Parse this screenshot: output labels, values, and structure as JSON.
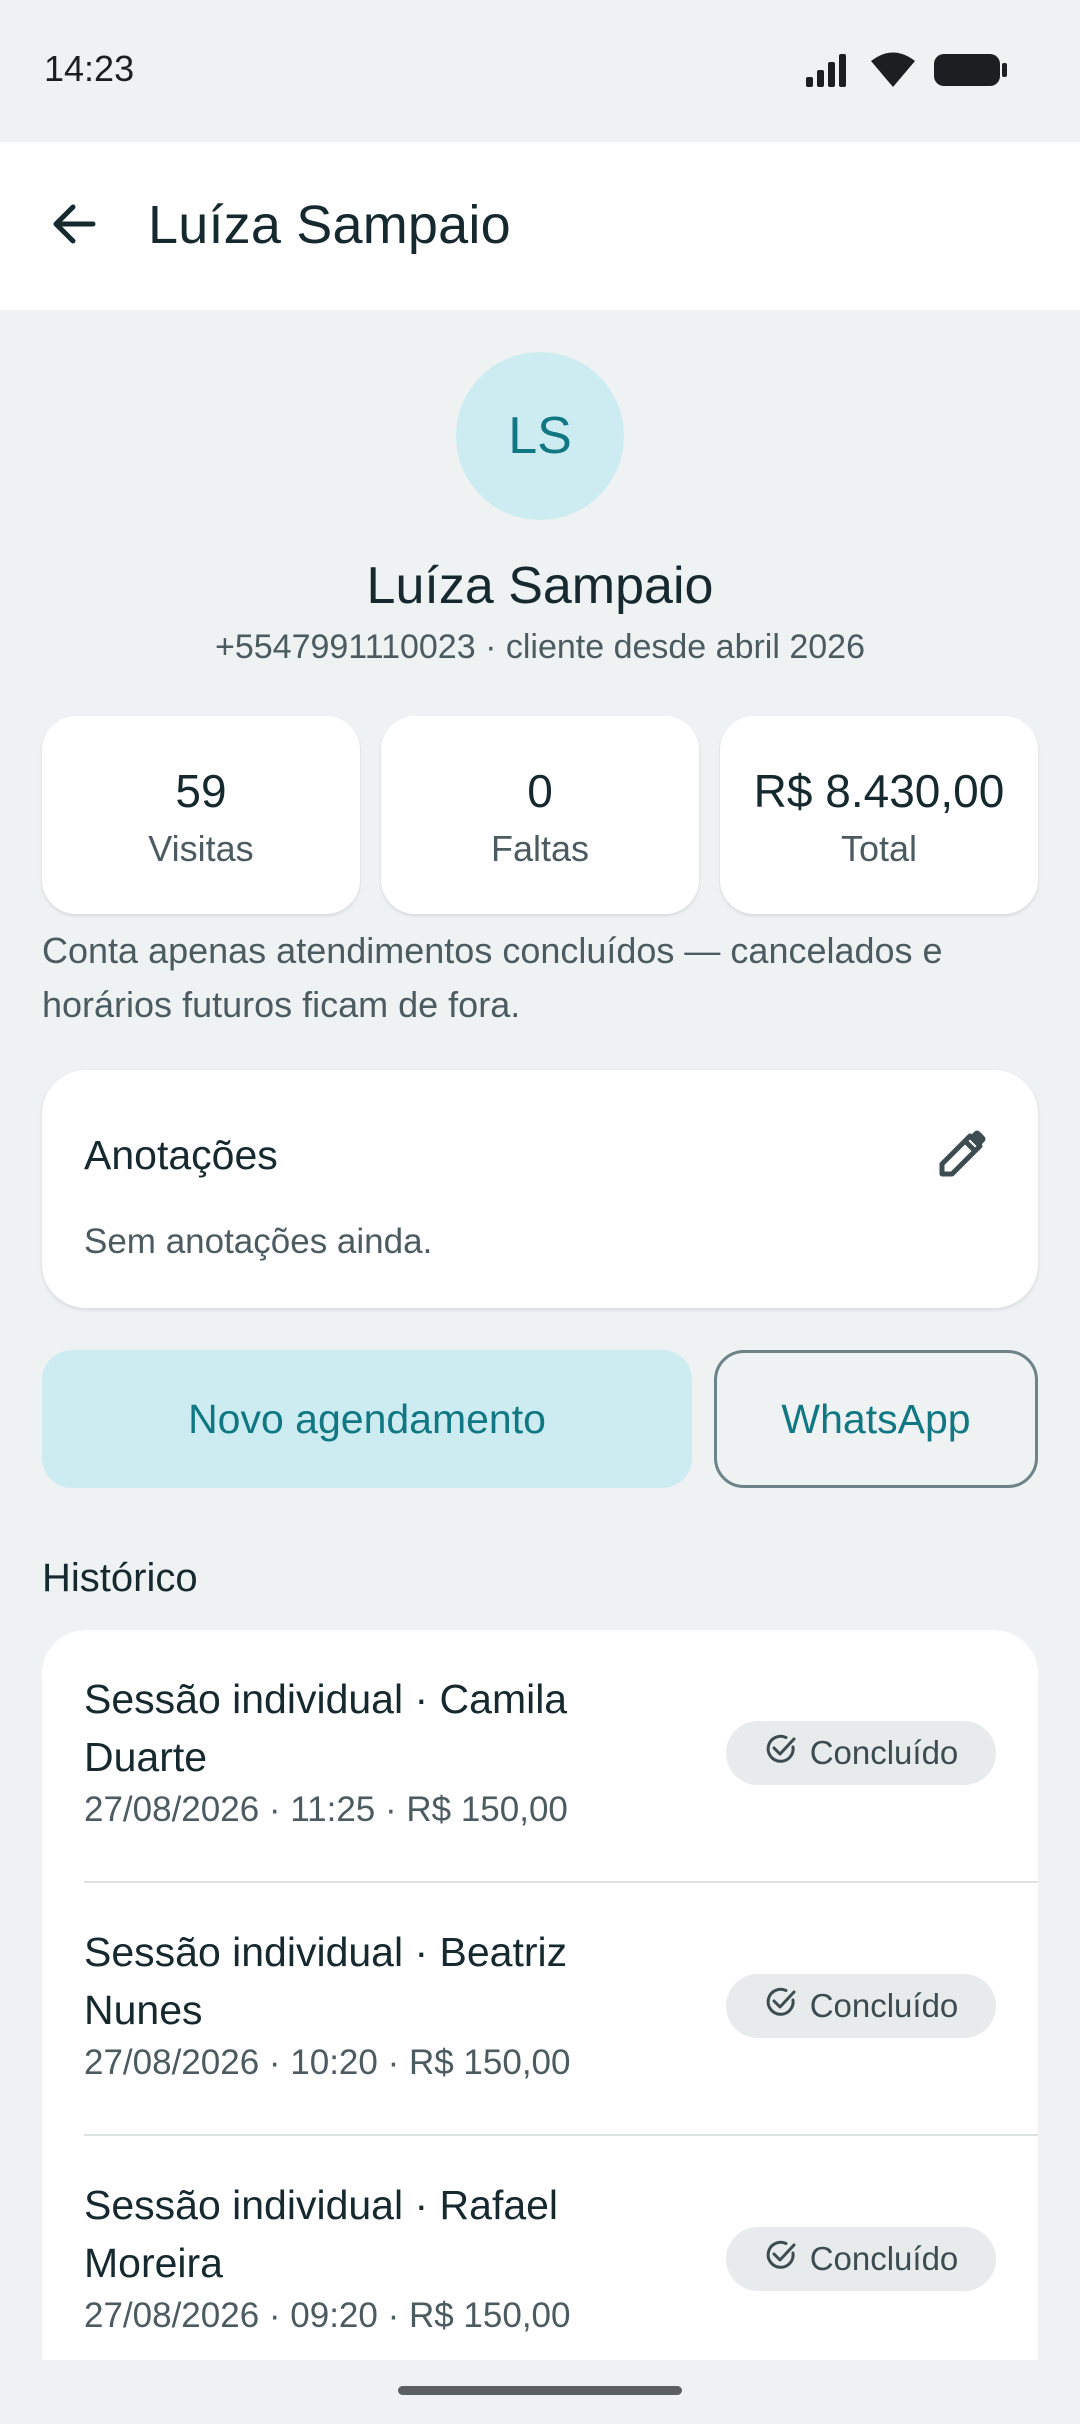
{
  "status_bar": {
    "time": "14:23",
    "icons": [
      "signal-icon",
      "wifi-icon",
      "battery-icon"
    ]
  },
  "app_bar": {
    "title": "Luíza Sampaio",
    "back_icon": "arrow-left-icon"
  },
  "profile": {
    "initials": "LS",
    "name": "Luíza Sampaio",
    "subtitle": "+5547991110023 · cliente desde abril 2026"
  },
  "stats": [
    {
      "value": "59",
      "label": "Visitas"
    },
    {
      "value": "0",
      "label": "Faltas"
    },
    {
      "value": "R$ 8.430,00",
      "label": "Total"
    }
  ],
  "stats_note": "Conta apenas atendimentos concluídos — cancelados e horários futuros ficam de fora.",
  "notes": {
    "title": "Anotações",
    "body": "Sem anotações ainda.",
    "edit_icon": "pencil-icon"
  },
  "actions": {
    "new_appointment": "Novo agendamento",
    "whatsapp": "WhatsApp"
  },
  "history": {
    "title": "Histórico",
    "items": [
      {
        "title": "Sessão individual · Camila Duarte",
        "meta": "27/08/2026 · 11:25 · R$ 150,00",
        "status": "Concluído"
      },
      {
        "title": "Sessão individual · Beatriz Nunes",
        "meta": "27/08/2026 · 10:20 · R$ 150,00",
        "status": "Concluído"
      },
      {
        "title": "Sessão individual · Rafael Moreira",
        "meta": "27/08/2026 · 09:20 · R$ 150,00",
        "status": "Concluído"
      }
    ]
  },
  "colors": {
    "accent": "#107783",
    "accent_container": "#cdecf1",
    "background": "#eef2f3",
    "surface": "#ffffff"
  }
}
